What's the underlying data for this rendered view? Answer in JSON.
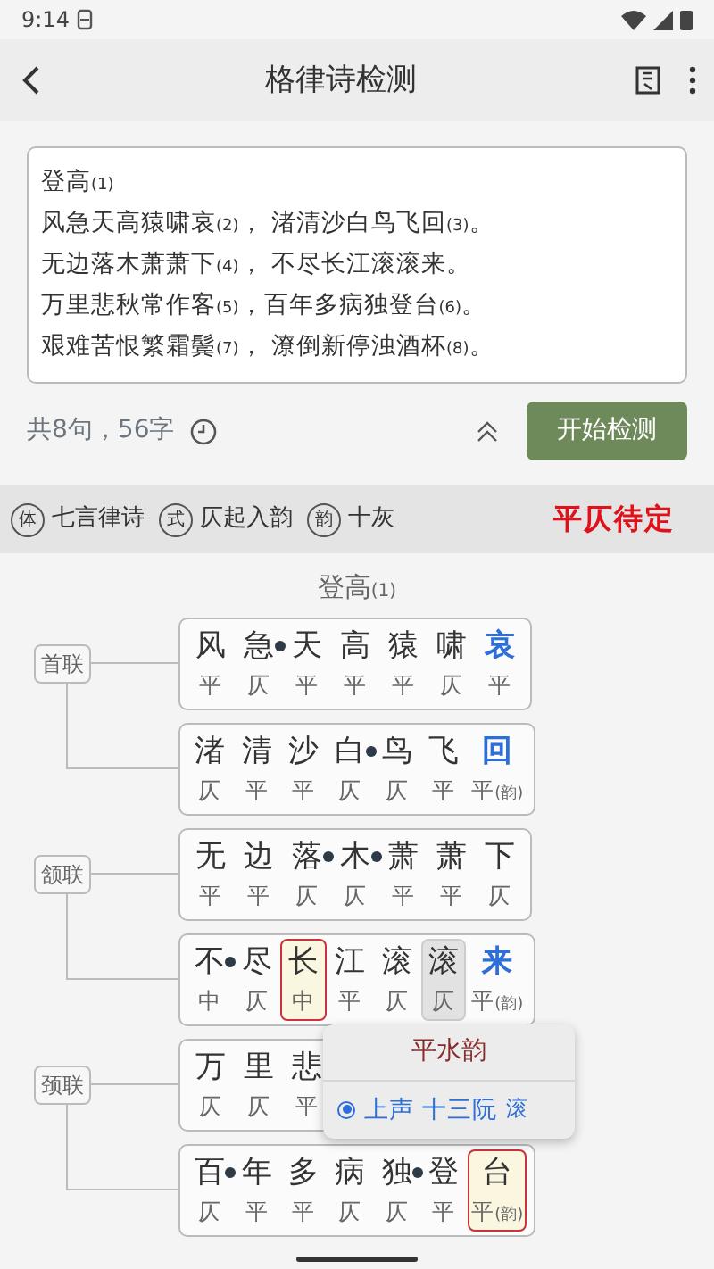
{
  "status_bar": {
    "time": "9:14"
  },
  "app_bar": {
    "title": "格律诗检测"
  },
  "editor": {
    "lines": [
      "登高$_{(1)}$",
      "风急天高猿啸哀$_{(2)}$， 渚清沙白鸟飞回$_{(3)}$。",
      "无边落木萧萧下$_{(4)}$， 不尽长江滚滚来。",
      "万里悲秋常作客$_{(5)}$，百年多病独登台$_{(6)}$。",
      "艰难苦恨繁霜鬓$_{(7)}$， 潦倒新停浊酒杯$_{(8)}$。"
    ]
  },
  "summary": "共8句，56字",
  "check_button": "开始检测",
  "info_bar": {
    "tags": [
      {
        "mark": "体",
        "text": "七言律诗"
      },
      {
        "mark": "式",
        "text": "仄起入韵"
      },
      {
        "mark": "韵",
        "text": "十灰"
      }
    ],
    "verdict": "平仄待定"
  },
  "poem_title": "登高$_{(1)}$",
  "couplets": [
    {
      "label": "首联",
      "lines": [
        {
          "chars": [
            {
              "char": "风",
              "tone": "平"
            },
            {
              "char": "急",
              "tone": "仄",
              "entering": true
            },
            {
              "char": "天",
              "tone": "平"
            },
            {
              "char": "高",
              "tone": "平"
            },
            {
              "char": "猿",
              "tone": "平"
            },
            {
              "char": "啸",
              "tone": "仄"
            },
            {
              "char": "哀",
              "tone": "平",
              "rhyme": true
            }
          ]
        },
        {
          "chars": [
            {
              "char": "渚",
              "tone": "仄"
            },
            {
              "char": "清",
              "tone": "平"
            },
            {
              "char": "沙",
              "tone": "平"
            },
            {
              "char": "白",
              "tone": "仄",
              "entering": true
            },
            {
              "char": "鸟",
              "tone": "仄"
            },
            {
              "char": "飞",
              "tone": "平"
            },
            {
              "char": "回",
              "tone": "平",
              "note": "(韵)",
              "rhyme": true
            }
          ]
        }
      ]
    },
    {
      "label": "颔联",
      "lines": [
        {
          "chars": [
            {
              "char": "无",
              "tone": "平"
            },
            {
              "char": "边",
              "tone": "平"
            },
            {
              "char": "落",
              "tone": "仄",
              "entering": true
            },
            {
              "char": "木",
              "tone": "仄",
              "entering": true
            },
            {
              "char": "萧",
              "tone": "平"
            },
            {
              "char": "萧",
              "tone": "平"
            },
            {
              "char": "下",
              "tone": "仄"
            }
          ]
        },
        {
          "chars": [
            {
              "char": "不",
              "tone": "中",
              "entering": true
            },
            {
              "char": "尽",
              "tone": "仄"
            },
            {
              "char": "长",
              "tone": "中",
              "flagged": true
            },
            {
              "char": "江",
              "tone": "平"
            },
            {
              "char": "滚",
              "tone": "仄"
            },
            {
              "char": "滚",
              "tone": "仄",
              "highlighted": true
            },
            {
              "char": "来",
              "tone": "平",
              "note": "(韵)",
              "rhyme": true
            }
          ]
        }
      ]
    },
    {
      "label": "颈联",
      "lines": [
        {
          "chars": [
            {
              "char": "万",
              "tone": "仄"
            },
            {
              "char": "里",
              "tone": "仄"
            },
            {
              "char": "悲",
              "tone": "平"
            }
          ],
          "popup": {
            "title": "平水韵",
            "options": [
              {
                "text": "上声 十三阮",
                "char": "滚",
                "selected": true
              }
            ]
          }
        },
        {
          "chars": [
            {
              "char": "百",
              "tone": "仄",
              "entering": true
            },
            {
              "char": "年",
              "tone": "平"
            },
            {
              "char": "多",
              "tone": "平"
            },
            {
              "char": "病",
              "tone": "仄"
            },
            {
              "char": "独",
              "tone": "仄",
              "entering": true
            },
            {
              "char": "登",
              "tone": "平"
            },
            {
              "char": "台",
              "tone": "平",
              "note": "(韵)",
              "flagged": true
            }
          ]
        }
      ]
    }
  ]
}
